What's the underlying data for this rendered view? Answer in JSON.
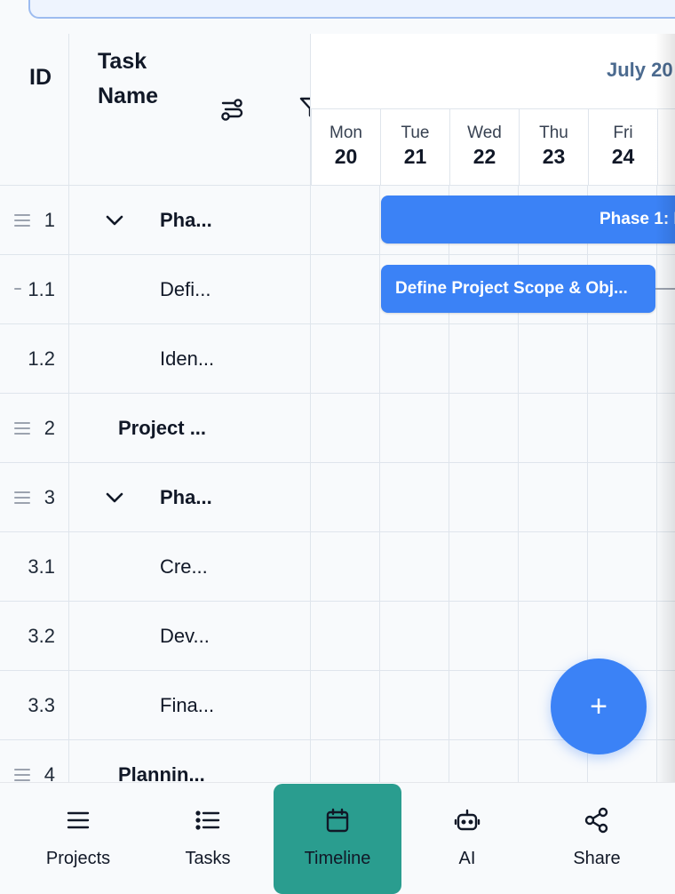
{
  "header": {
    "id_label": "ID",
    "task_name_label_line1": "Task",
    "task_name_label_line2": "Name",
    "month_label": "July 20"
  },
  "days": [
    {
      "name": "Mon",
      "num": "20"
    },
    {
      "name": "Tue",
      "num": "21"
    },
    {
      "name": "Wed",
      "num": "22"
    },
    {
      "name": "Thu",
      "num": "23"
    },
    {
      "name": "Fri",
      "num": "24"
    }
  ],
  "rows": [
    {
      "id": "1",
      "name": "Pha...",
      "bold": true,
      "expandable": true,
      "drag": true
    },
    {
      "id": "1.1",
      "name": "Defi...",
      "bold": false,
      "expandable": false,
      "drag": true
    },
    {
      "id": "1.2",
      "name": "Iden...",
      "bold": false,
      "expandable": false,
      "drag": false
    },
    {
      "id": "2",
      "name": "Project ...",
      "bold": true,
      "expandable": false,
      "drag": true
    },
    {
      "id": "3",
      "name": "Pha...",
      "bold": true,
      "expandable": true,
      "drag": true
    },
    {
      "id": "3.1",
      "name": "Cre...",
      "bold": false,
      "expandable": false,
      "drag": false
    },
    {
      "id": "3.2",
      "name": "Dev...",
      "bold": false,
      "expandable": false,
      "drag": false
    },
    {
      "id": "3.3",
      "name": "Fina...",
      "bold": false,
      "expandable": false,
      "drag": false
    },
    {
      "id": "4",
      "name": "Plannin...",
      "bold": true,
      "expandable": false,
      "drag": true
    }
  ],
  "bars": {
    "phase1_label": "Phase 1: I",
    "define_label": "Define Project Scope & Obj..."
  },
  "fab": {
    "label": "+"
  },
  "nav": [
    {
      "label": "Projects",
      "icon": "menu-icon",
      "active": false
    },
    {
      "label": "Tasks",
      "icon": "list-icon",
      "active": false
    },
    {
      "label": "Timeline",
      "icon": "calendar-icon",
      "active": true
    },
    {
      "label": "AI",
      "icon": "robot-icon",
      "active": false
    },
    {
      "label": "Share",
      "icon": "share-icon",
      "active": false
    }
  ],
  "colors": {
    "accent": "#3b82f6",
    "active_nav": "#2a9d8f",
    "month_text": "#4b6a8f"
  }
}
